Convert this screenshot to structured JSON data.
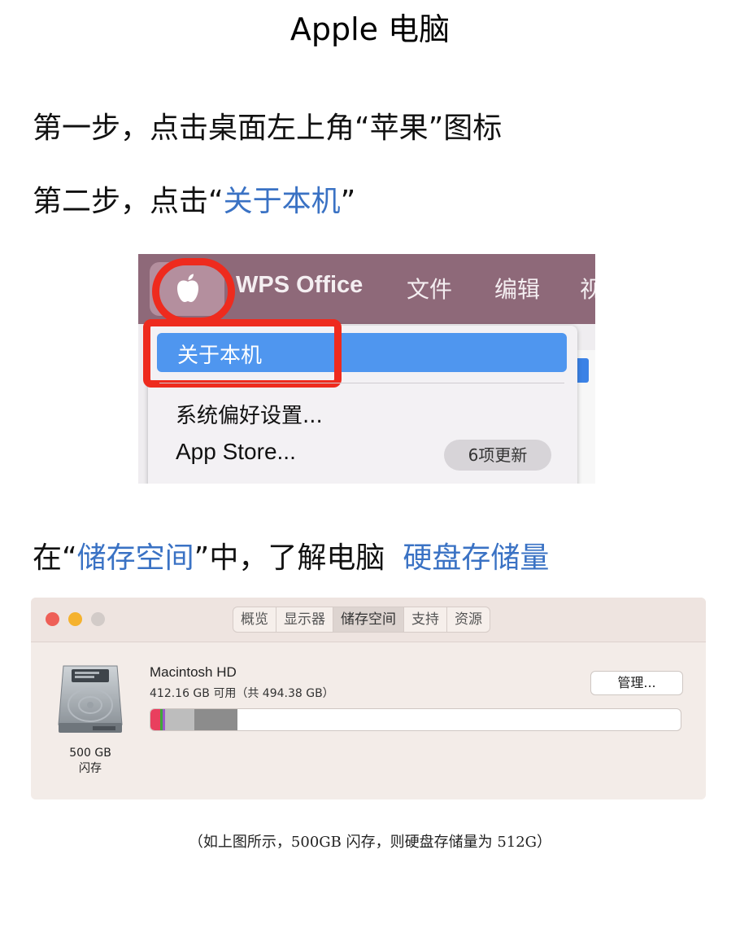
{
  "doc": {
    "title": "Apple 电脑",
    "step1": "第一步，点击桌面左上角“苹果”图标",
    "step2_prefix": "第二步，点击“",
    "step2_highlight": "关于本机",
    "step2_suffix": "”",
    "step3_prefix": "在“",
    "step3_highlight1": "储存空间",
    "step3_middle": "”中，了解电脑",
    "step3_highlight2": "硬盘存储量",
    "caption": "（如上图所示，500GB 闪存，则硬盘存储量为 512G）"
  },
  "menu_screenshot": {
    "menubar": [
      "WPS Office",
      "文件",
      "编辑",
      "视"
    ],
    "items": {
      "about": "关于本机",
      "preferences": "系统偏好设置...",
      "app_store": "App Store...",
      "updates_badge": "6项更新"
    },
    "colors": {
      "menubar": "#8e6979",
      "highlight": "#4f96ef",
      "annotation": "#ee2b1e"
    }
  },
  "storage_screenshot": {
    "tabs": [
      "概览",
      "显示器",
      "储存空间",
      "支持",
      "资源"
    ],
    "selected_tab": "储存空间",
    "drive": {
      "size": "500 GB",
      "type": "闪存",
      "name": "Macintosh HD",
      "available": "412.16 GB 可用（共 494.38 GB）",
      "manage_button": "管理...",
      "usage_segments": [
        {
          "fraction": 0.018,
          "color": "#e93f5e"
        },
        {
          "fraction": 0.004,
          "color": "#3fa73c"
        },
        {
          "fraction": 0.004,
          "color": "#9b57c9"
        },
        {
          "fraction": 0.055,
          "color": "#bdbdbd"
        },
        {
          "fraction": 0.082,
          "color": "#8c8c8c"
        }
      ]
    }
  }
}
